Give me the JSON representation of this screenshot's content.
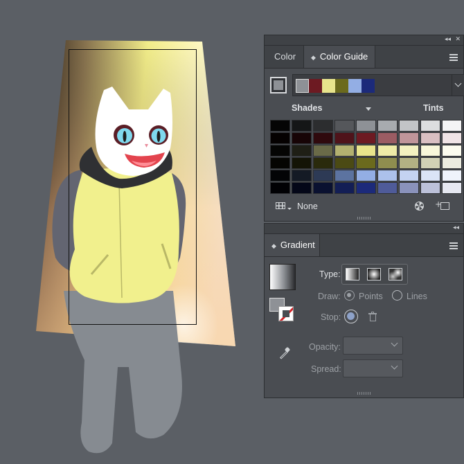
{
  "color_panel": {
    "tabs": [
      {
        "label": "Color",
        "active": false
      },
      {
        "label": "Color Guide",
        "active": true
      }
    ],
    "current_color": "#8e9196",
    "harmony_colors": [
      "#8e9196",
      "#6d1a22",
      "#e8e48c",
      "#6b6a1d",
      "#93aee4",
      "#1c2a7a"
    ],
    "shades_label": "Shades",
    "tints_label": "Tints",
    "grid_rows": [
      [
        "#050505",
        "#151617",
        "#2c2d2f",
        "#55575b",
        "#8e9196",
        "#a8abaf",
        "#c2c4c7",
        "#dcdddf",
        "#f4f4f5"
      ],
      [
        "#050101",
        "#170406",
        "#2f090d",
        "#4f131a",
        "#6d1a22",
        "#9b5c63",
        "#c0959a",
        "#d9bfc2",
        "#f0e4e6"
      ],
      [
        "#050504",
        "#1f1f16",
        "#6a6a48",
        "#b3b170",
        "#e8e48c",
        "#eeeba7",
        "#f3f1c0",
        "#f8f7da",
        "#fcfcef"
      ],
      [
        "#050502",
        "#141406",
        "#2a2a0c",
        "#4b4a14",
        "#6b6a1d",
        "#8f8e4f",
        "#b2b183",
        "#d1d1b5",
        "#ecece0"
      ],
      [
        "#030406",
        "#141a25",
        "#2d3a55",
        "#5c73a0",
        "#93aee4",
        "#acc1eb",
        "#c4d3f1",
        "#dae4f6",
        "#eff3fb"
      ],
      [
        "#010104",
        "#040718",
        "#0a1130",
        "#131e55",
        "#1c2a7a",
        "#4f5b99",
        "#8a92bb",
        "#bcc1d9",
        "#e6e8f1"
      ]
    ],
    "none_label": "None"
  },
  "gradient_panel": {
    "tab_label": "Gradient",
    "type_label": "Type:",
    "draw_label": "Draw:",
    "points_label": "Points",
    "lines_label": "Lines",
    "stop_label": "Stop:",
    "opacity_label": "Opacity:",
    "spread_label": "Spread:"
  }
}
